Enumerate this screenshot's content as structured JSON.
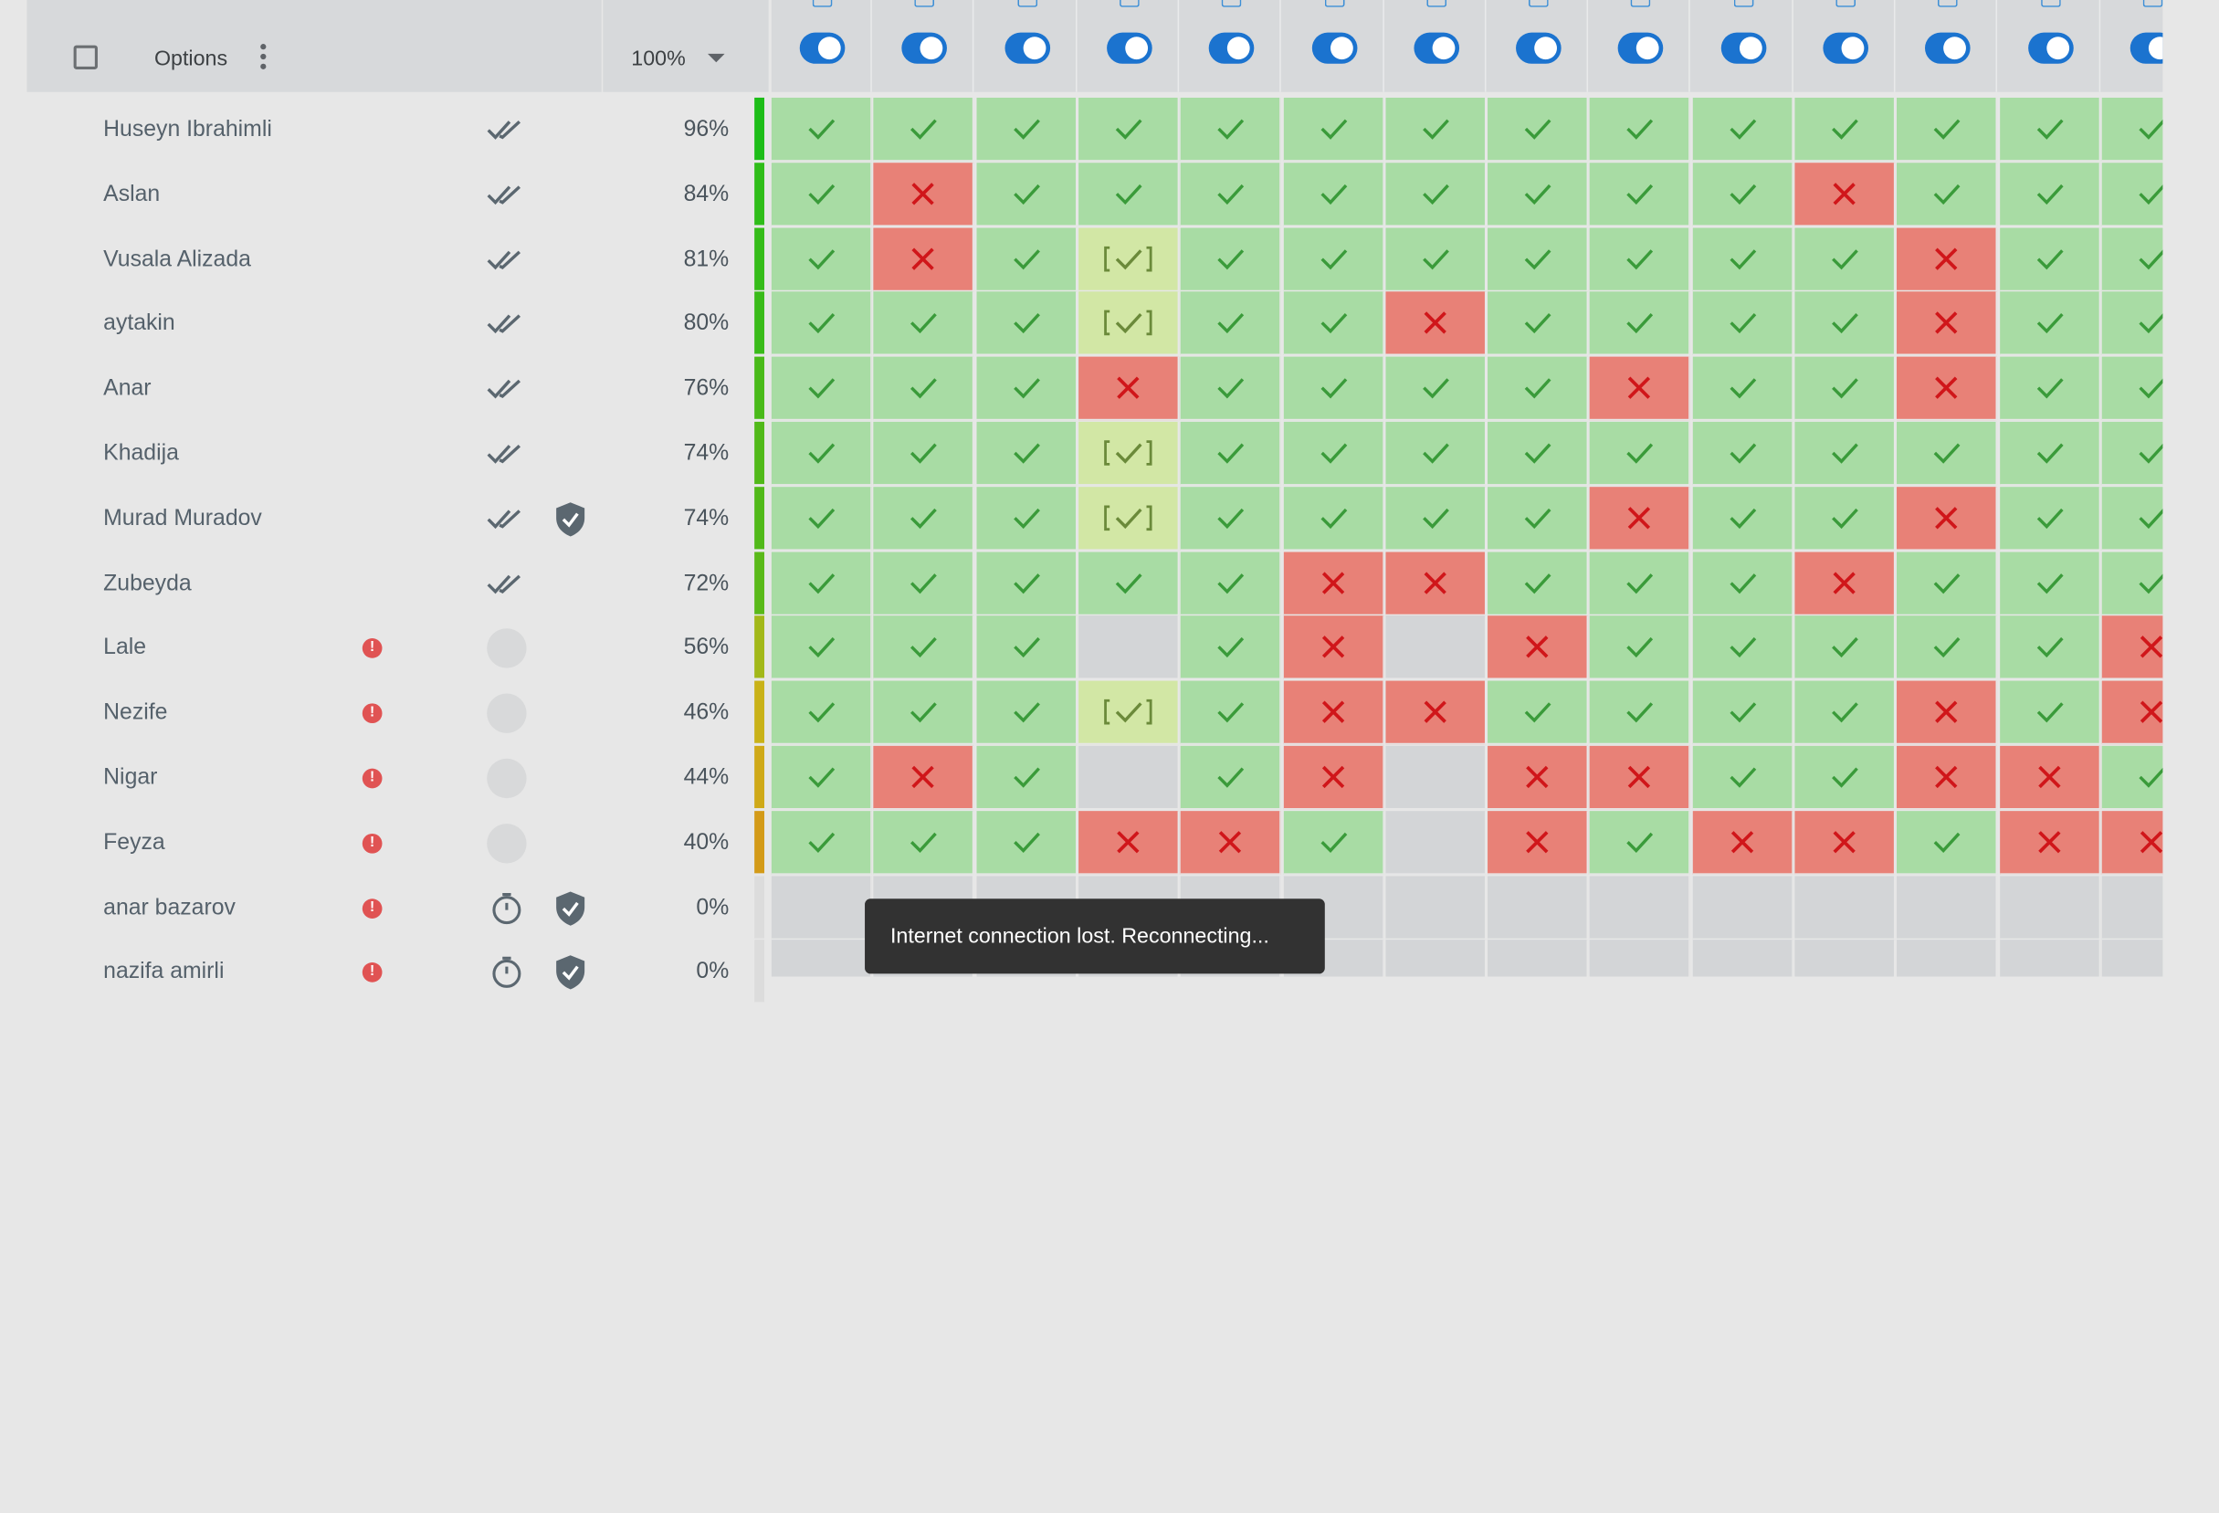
{
  "header": {
    "options_label": "Options",
    "zoom_label": "100%",
    "columns": 14
  },
  "students": [
    {
      "name": "Huseyn Ibrahimli",
      "pct": "96%",
      "status": "double-check",
      "shield": false,
      "bar": "#1dbd18"
    },
    {
      "name": "Aslan",
      "pct": "84%",
      "status": "double-check",
      "shield": false,
      "bar": "#2fbd19"
    },
    {
      "name": "Vusala Alizada",
      "pct": "81%",
      "status": "double-check",
      "shield": false,
      "bar": "#35bc19"
    },
    {
      "name": "aytakin",
      "pct": "80%",
      "status": "double-check",
      "shield": false,
      "bar": "#39bb19"
    },
    {
      "name": "Anar",
      "pct": "76%",
      "status": "double-check",
      "shield": false,
      "bar": "#49ba19"
    },
    {
      "name": "Khadija",
      "pct": "74%",
      "status": "double-check",
      "shield": false,
      "bar": "#51b919"
    },
    {
      "name": "Murad Muradov",
      "pct": "74%",
      "status": "double-check",
      "shield": true,
      "bar": "#51b919"
    },
    {
      "name": "Zubeyda",
      "pct": "72%",
      "status": "double-check",
      "shield": false,
      "bar": "#5ab919"
    },
    {
      "name": "Lale",
      "pct": "56%",
      "status": "alert-empty",
      "shield": false,
      "bar": "#a2b819"
    },
    {
      "name": "Nezife",
      "pct": "46%",
      "status": "alert-empty",
      "shield": false,
      "bar": "#c9b218"
    },
    {
      "name": "Nigar",
      "pct": "44%",
      "status": "alert-empty",
      "shield": false,
      "bar": "#cfa918"
    },
    {
      "name": "Feyza",
      "pct": "40%",
      "status": "alert-empty",
      "shield": false,
      "bar": "#d39a18"
    },
    {
      "name": "anar bazarov",
      "pct": "0%",
      "status": "alert-timer",
      "shield": true,
      "bar": "#dcdcdc"
    },
    {
      "name": "nazifa amirli",
      "pct": "0%",
      "status": "alert-timer",
      "shield": true,
      "bar": "#dcdcdc"
    }
  ],
  "cells": [
    [
      "ok",
      "ok",
      "ok",
      "ok",
      "ok",
      "ok",
      "ok",
      "ok",
      "ok",
      "ok",
      "ok",
      "ok",
      "ok",
      "ok"
    ],
    [
      "ok",
      "bad",
      "ok",
      "ok",
      "ok",
      "ok",
      "ok",
      "ok",
      "ok",
      "ok",
      "bad",
      "ok",
      "ok",
      "ok"
    ],
    [
      "ok",
      "bad",
      "ok",
      "partial",
      "ok",
      "ok",
      "ok",
      "ok",
      "ok",
      "ok",
      "ok",
      "bad",
      "ok",
      "ok"
    ],
    [
      "ok",
      "ok",
      "ok",
      "partial",
      "ok",
      "ok",
      "bad",
      "ok",
      "ok",
      "ok",
      "ok",
      "bad",
      "ok",
      "ok"
    ],
    [
      "ok",
      "ok",
      "ok",
      "bad",
      "ok",
      "ok",
      "ok",
      "ok",
      "bad",
      "ok",
      "ok",
      "bad",
      "ok",
      "ok"
    ],
    [
      "ok",
      "ok",
      "ok",
      "partial",
      "ok",
      "ok",
      "ok",
      "ok",
      "ok",
      "ok",
      "ok",
      "ok",
      "ok",
      "ok"
    ],
    [
      "ok",
      "ok",
      "ok",
      "partial",
      "ok",
      "ok",
      "ok",
      "ok",
      "bad",
      "ok",
      "ok",
      "bad",
      "ok",
      "ok"
    ],
    [
      "ok",
      "ok",
      "ok",
      "ok",
      "ok",
      "bad",
      "bad",
      "ok",
      "ok",
      "ok",
      "bad",
      "ok",
      "ok",
      "ok"
    ],
    [
      "ok",
      "ok",
      "ok",
      "none",
      "ok",
      "bad",
      "none",
      "bad",
      "ok",
      "ok",
      "ok",
      "ok",
      "ok",
      "bad"
    ],
    [
      "ok",
      "ok",
      "ok",
      "partial",
      "ok",
      "bad",
      "bad",
      "ok",
      "ok",
      "ok",
      "ok",
      "bad",
      "ok",
      "bad"
    ],
    [
      "ok",
      "bad",
      "ok",
      "none",
      "ok",
      "bad",
      "none",
      "bad",
      "bad",
      "ok",
      "ok",
      "bad",
      "bad",
      "ok"
    ],
    [
      "ok",
      "ok",
      "ok",
      "bad",
      "bad",
      "ok",
      "none",
      "bad",
      "ok",
      "bad",
      "bad",
      "ok",
      "bad",
      "bad"
    ],
    [
      "none",
      "none",
      "none",
      "none",
      "none",
      "none",
      "none",
      "none",
      "none",
      "none",
      "none",
      "none",
      "none",
      "none"
    ],
    [
      "none",
      "none",
      "none",
      "none",
      "none",
      "none",
      "none",
      "none",
      "none",
      "none",
      "none",
      "none",
      "none",
      "none"
    ]
  ],
  "toast": {
    "message": "Internet connection lost. Reconnecting..."
  },
  "colors": {
    "accent": "#1b73cf",
    "ok": "#a8dca4",
    "bad": "#e88177",
    "partial": "#d2e7a5",
    "none": "#d3d5d7"
  }
}
